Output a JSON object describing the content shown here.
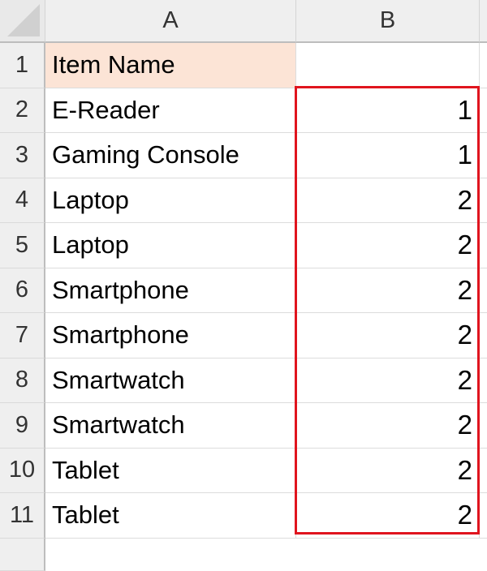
{
  "columns": [
    "A",
    "B"
  ],
  "rows": [
    {
      "num": "1",
      "a": "Item Name",
      "b": ""
    },
    {
      "num": "2",
      "a": "E-Reader",
      "b": "1"
    },
    {
      "num": "3",
      "a": "Gaming Console",
      "b": "1"
    },
    {
      "num": "4",
      "a": "Laptop",
      "b": "2"
    },
    {
      "num": "5",
      "a": "Laptop",
      "b": "2"
    },
    {
      "num": "6",
      "a": "Smartphone",
      "b": "2"
    },
    {
      "num": "7",
      "a": "Smartphone",
      "b": "2"
    },
    {
      "num": "8",
      "a": "Smartwatch",
      "b": "2"
    },
    {
      "num": "9",
      "a": "Smartwatch",
      "b": "2"
    },
    {
      "num": "10",
      "a": "Tablet",
      "b": "2"
    },
    {
      "num": "11",
      "a": "Tablet",
      "b": "2"
    }
  ],
  "colors": {
    "header_fill": "#fce4d6",
    "selection_border": "#e0141e"
  }
}
